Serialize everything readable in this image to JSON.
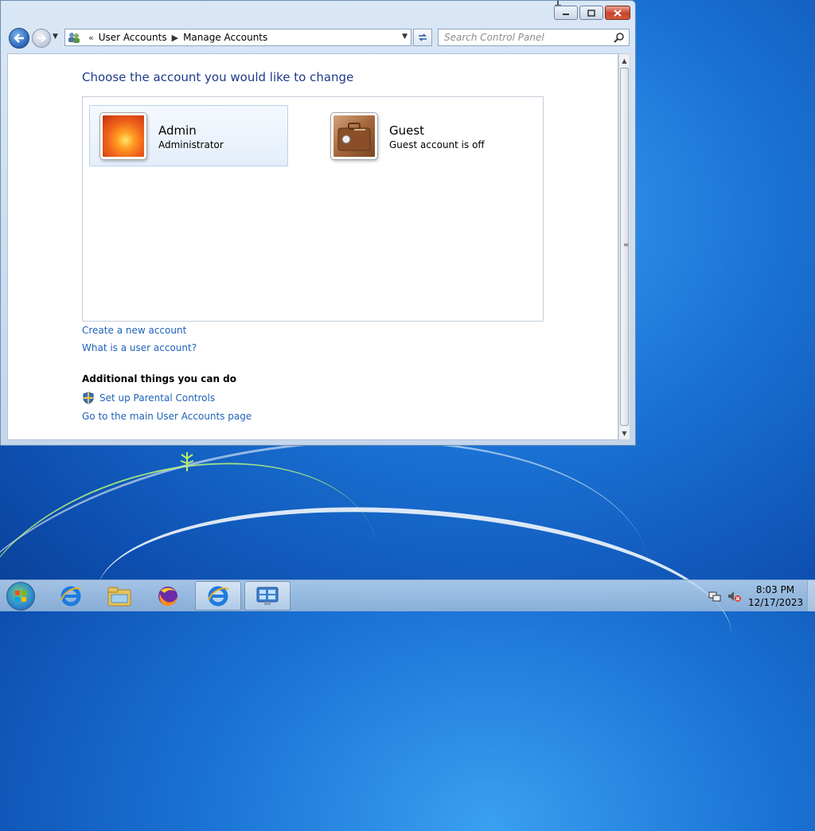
{
  "window": {
    "address": {
      "breadcrumbs": [
        "User Accounts",
        "Manage Accounts"
      ],
      "overflow_glyph": "«"
    },
    "search_placeholder": "Search Control Panel"
  },
  "content": {
    "title": "Choose the account you would like to change",
    "accounts": [
      {
        "name": "Admin",
        "role": "Administrator",
        "selected": true,
        "avatar": "flower-icon"
      },
      {
        "name": "Guest",
        "role": "Guest account is off",
        "selected": false,
        "avatar": "briefcase-icon"
      }
    ],
    "links": {
      "create": "Create a new account",
      "what": "What is a user account?"
    },
    "additional": {
      "heading": "Additional things you can do",
      "parental": "Set up Parental Controls",
      "main_page": "Go to the main User Accounts page"
    }
  },
  "taskbar": {
    "items": [
      "internet-explorer-icon",
      "windows-explorer-icon",
      "firefox-icon",
      "internet-explorer-icon",
      "control-panel-icon"
    ],
    "clock": {
      "time": "8:03 PM",
      "date": "12/17/2023"
    }
  },
  "colors": {
    "link": "#1e63b8",
    "title": "#1e3a8a",
    "selection_bg": "#e5eefa"
  }
}
